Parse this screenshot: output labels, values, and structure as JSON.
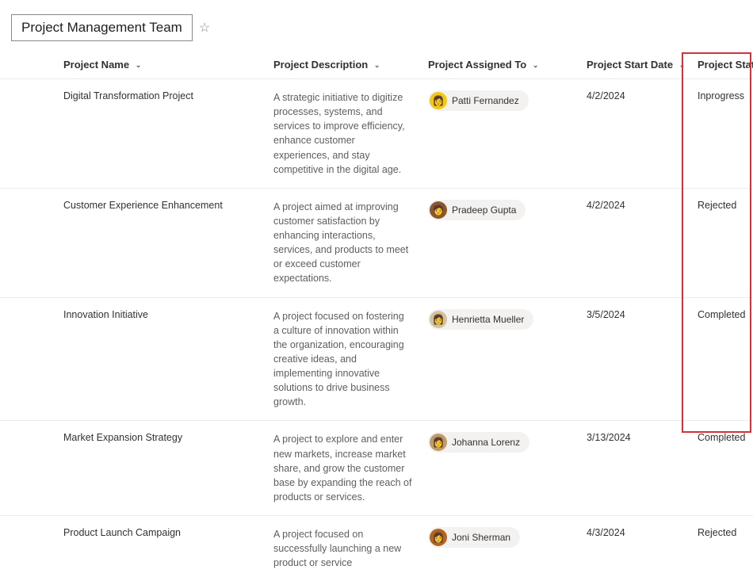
{
  "title": "Project Management Team",
  "columns": {
    "name": "Project Name",
    "description": "Project Description",
    "assigned": "Project Assigned To",
    "start": "Project Start Date",
    "status": "Project Status"
  },
  "rows": [
    {
      "name": "Digital Transformation Project",
      "description": "A strategic initiative to digitize processes, systems, and services to improve efficiency, enhance customer experiences, and stay competitive in the digital age.",
      "assigned": "Patti Fernandez",
      "avatar_bg": "#f2c811",
      "avatar_glyph": "👩",
      "start": "4/2/2024",
      "status": "Inprogress"
    },
    {
      "name": "Customer Experience Enhancement",
      "description": "A project aimed at improving customer satisfaction by enhancing interactions, services, and products to meet or exceed customer expectations.",
      "assigned": "Pradeep Gupta",
      "avatar_bg": "#8e562e",
      "avatar_glyph": "🧑",
      "start": "4/2/2024",
      "status": "Rejected"
    },
    {
      "name": "Innovation Initiative",
      "description": "A project focused on fostering a culture of innovation within the organization, encouraging creative ideas, and implementing innovative solutions to drive business growth.",
      "assigned": "Henrietta Mueller",
      "avatar_bg": "#d4c29a",
      "avatar_glyph": "👩",
      "start": "3/5/2024",
      "status": "Completed"
    },
    {
      "name": "Market Expansion Strategy",
      "description": "A project to explore and enter new markets, increase market share, and grow the customer base by expanding the reach of products or services.",
      "assigned": "Johanna Lorenz",
      "avatar_bg": "#c19a6b",
      "avatar_glyph": "👩",
      "start": "3/13/2024",
      "status": "Completed"
    },
    {
      "name": "Product Launch Campaign",
      "description": "A project focused on successfully launching a new product or service",
      "assigned": "Joni Sherman",
      "avatar_bg": "#b5651d",
      "avatar_glyph": "👩",
      "start": "4/3/2024",
      "status": "Rejected"
    }
  ]
}
